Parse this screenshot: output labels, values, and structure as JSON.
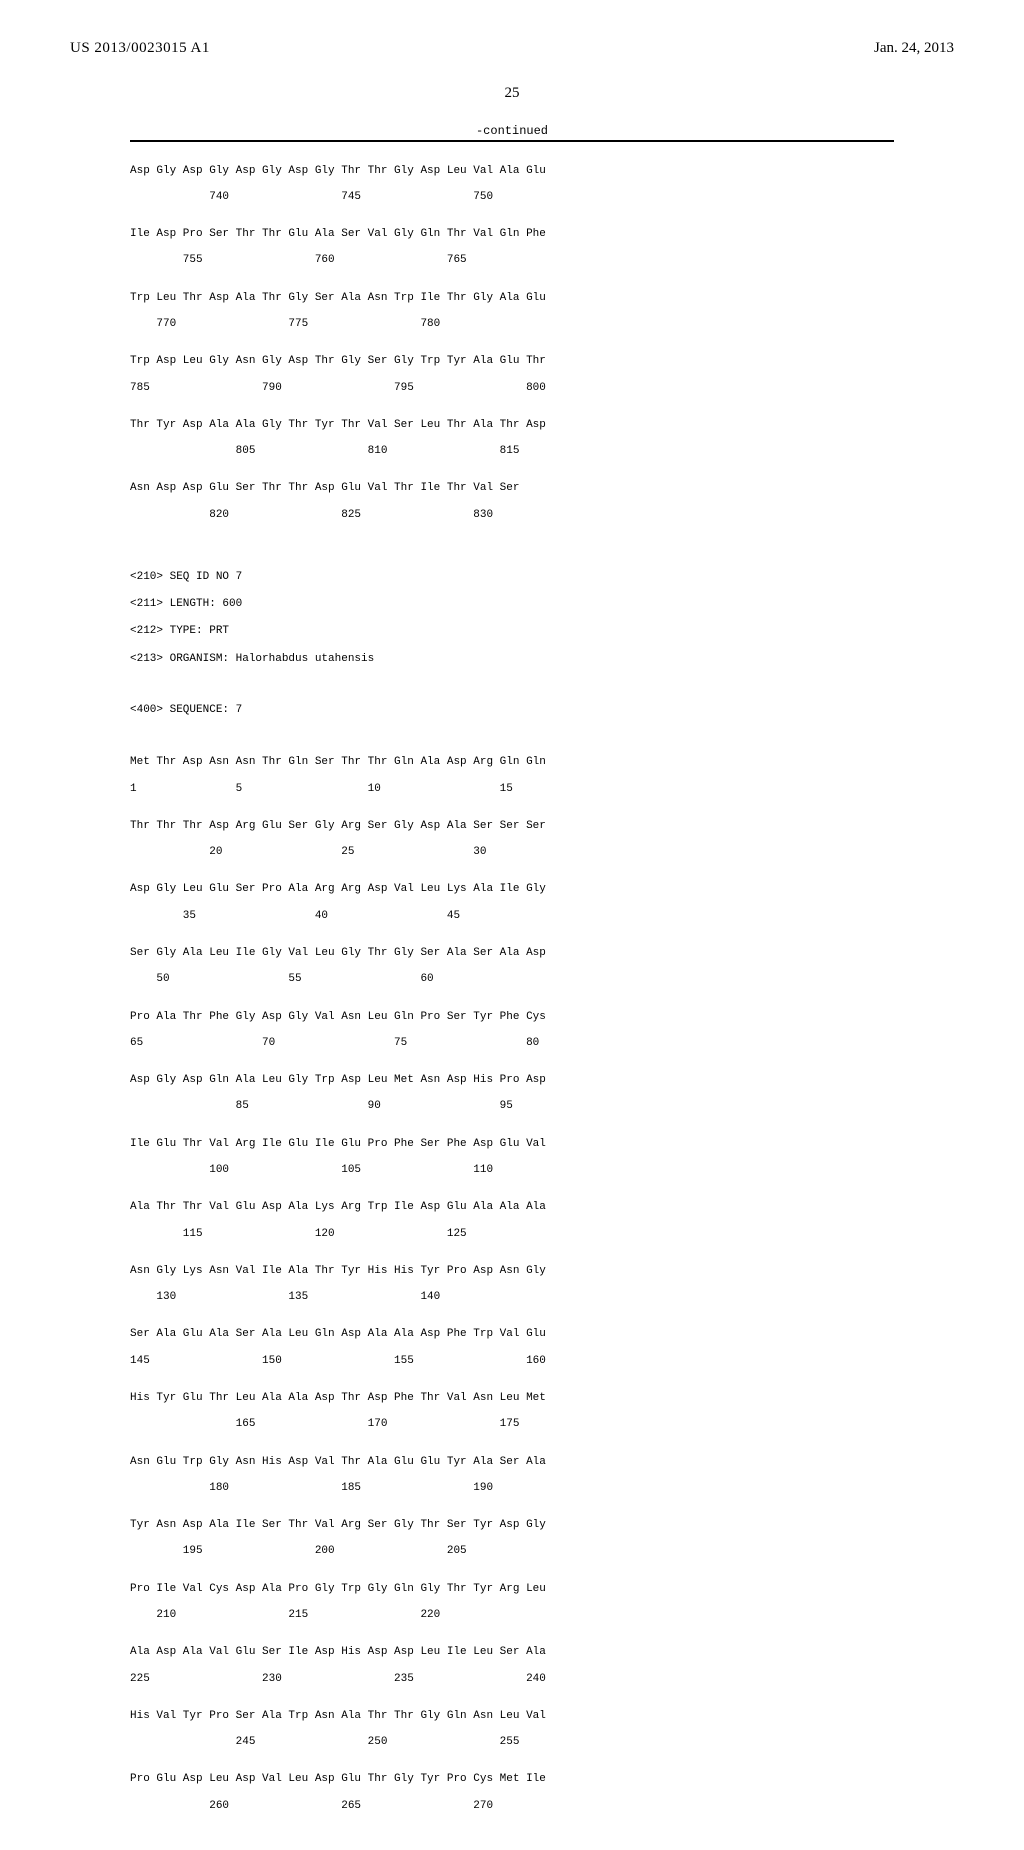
{
  "header": {
    "pub_number": "US 2013/0023015 A1",
    "pub_date": "Jan. 24, 2013"
  },
  "page_number": "25",
  "continued_label": "-continued",
  "seq7_meta": {
    "l1": "<210> SEQ ID NO 7",
    "l2": "<211> LENGTH: 600",
    "l3": "<212> TYPE: PRT",
    "l4": "<213> ORGANISM: Halorhabdus utahensis",
    "l5": "<400> SEQUENCE: 7"
  },
  "rows": {
    "r740a": "Asp Gly Asp Gly Asp Gly Asp Gly Thr Thr Gly Asp Leu Val Ala Glu",
    "r740b": "            740                 745                 750",
    "r755a": "Ile Asp Pro Ser Thr Thr Glu Ala Ser Val Gly Gln Thr Val Gln Phe",
    "r755b": "        755                 760                 765",
    "r770a": "Trp Leu Thr Asp Ala Thr Gly Ser Ala Asn Trp Ile Thr Gly Ala Glu",
    "r770b": "    770                 775                 780",
    "r785a": "Trp Asp Leu Gly Asn Gly Asp Thr Gly Ser Gly Trp Tyr Ala Glu Thr",
    "r785b": "785                 790                 795                 800",
    "r805a": "Thr Tyr Asp Ala Ala Gly Thr Tyr Thr Val Ser Leu Thr Ala Thr Asp",
    "r805b": "                805                 810                 815",
    "r820a": "Asn Asp Asp Glu Ser Thr Thr Asp Glu Val Thr Ile Thr Val Ser",
    "r820b": "            820                 825                 830",
    "r1a": "Met Thr Asp Asn Asn Thr Gln Ser Thr Thr Gln Ala Asp Arg Gln Gln",
    "r1b": "1               5                   10                  15",
    "r20a": "Thr Thr Thr Asp Arg Glu Ser Gly Arg Ser Gly Asp Ala Ser Ser Ser",
    "r20b": "            20                  25                  30",
    "r35a": "Asp Gly Leu Glu Ser Pro Ala Arg Arg Asp Val Leu Lys Ala Ile Gly",
    "r35b": "        35                  40                  45",
    "r50a": "Ser Gly Ala Leu Ile Gly Val Leu Gly Thr Gly Ser Ala Ser Ala Asp",
    "r50b": "    50                  55                  60",
    "r65a": "Pro Ala Thr Phe Gly Asp Gly Val Asn Leu Gln Pro Ser Tyr Phe Cys",
    "r65b": "65                  70                  75                  80",
    "r85a": "Asp Gly Asp Gln Ala Leu Gly Trp Asp Leu Met Asn Asp His Pro Asp",
    "r85b": "                85                  90                  95",
    "r100a": "Ile Glu Thr Val Arg Ile Glu Ile Glu Pro Phe Ser Phe Asp Glu Val",
    "r100b": "            100                 105                 110",
    "r115a": "Ala Thr Thr Val Glu Asp Ala Lys Arg Trp Ile Asp Glu Ala Ala Ala",
    "r115b": "        115                 120                 125",
    "r130a": "Asn Gly Lys Asn Val Ile Ala Thr Tyr His His Tyr Pro Asp Asn Gly",
    "r130b": "    130                 135                 140",
    "r145a": "Ser Ala Glu Ala Ser Ala Leu Gln Asp Ala Ala Asp Phe Trp Val Glu",
    "r145b": "145                 150                 155                 160",
    "r165a": "His Tyr Glu Thr Leu Ala Ala Asp Thr Asp Phe Thr Val Asn Leu Met",
    "r165b": "                165                 170                 175",
    "r180a": "Asn Glu Trp Gly Asn His Asp Val Thr Ala Glu Glu Tyr Ala Ser Ala",
    "r180b": "            180                 185                 190",
    "r195a": "Tyr Asn Asp Ala Ile Ser Thr Val Arg Ser Gly Thr Ser Tyr Asp Gly",
    "r195b": "        195                 200                 205",
    "r210a": "Pro Ile Val Cys Asp Ala Pro Gly Trp Gly Gln Gly Thr Tyr Arg Leu",
    "r210b": "    210                 215                 220",
    "r225a": "Ala Asp Ala Val Glu Ser Ile Asp His Asp Asp Leu Ile Leu Ser Ala",
    "r225b": "225                 230                 235                 240",
    "r245a": "His Val Tyr Pro Ser Ala Trp Asn Ala Thr Thr Gly Gln Asn Leu Val",
    "r245b": "                245                 250                 255",
    "r260a": "Pro Glu Asp Leu Asp Val Leu Asp Glu Thr Gly Tyr Pro Cys Met Ile",
    "r260b": "            260                 265                 270"
  }
}
